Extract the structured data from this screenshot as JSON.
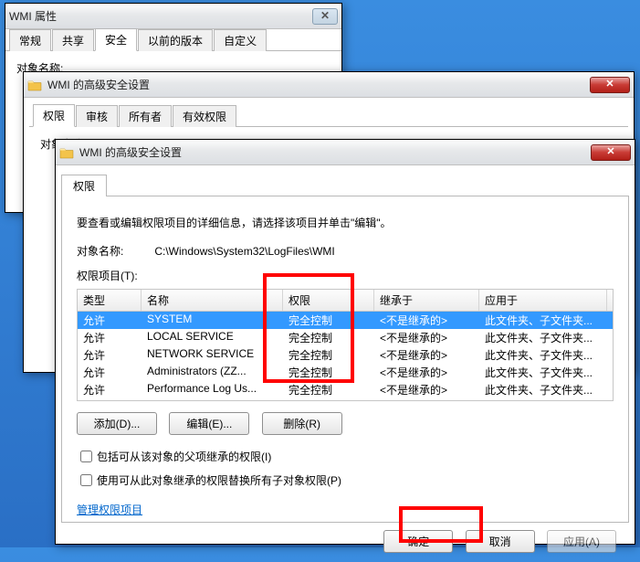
{
  "window1": {
    "title": "WMI 属性",
    "tabs": [
      "常规",
      "共享",
      "安全",
      "以前的版本",
      "自定义"
    ],
    "active_tab": 2,
    "obj_label": "对象名称:"
  },
  "window2": {
    "title": "WMI 的高级安全设置",
    "tabs": [
      "权限",
      "审核",
      "所有者",
      "有效权限"
    ],
    "active_tab": 0,
    "obj_label": "对象名称:"
  },
  "window3": {
    "title": "WMI 的高级安全设置",
    "tab_label": "权限",
    "instruction": "要查看或编辑权限项目的详细信息，请选择该项目并单击\"编辑\"。",
    "obj_label": "对象名称:",
    "obj_path": "C:\\Windows\\System32\\LogFiles\\WMI",
    "items_label": "权限项目(T):",
    "headers": {
      "type": "类型",
      "name": "名称",
      "perm": "权限",
      "inherit": "继承于",
      "apply": "应用于"
    },
    "rows": [
      {
        "type": "允许",
        "name": "SYSTEM",
        "perm": "完全控制",
        "inherit": "<不是继承的>",
        "apply": "此文件夹、子文件夹..."
      },
      {
        "type": "允许",
        "name": "LOCAL SERVICE",
        "perm": "完全控制",
        "inherit": "<不是继承的>",
        "apply": "此文件夹、子文件夹..."
      },
      {
        "type": "允许",
        "name": "NETWORK SERVICE",
        "perm": "完全控制",
        "inherit": "<不是继承的>",
        "apply": "此文件夹、子文件夹..."
      },
      {
        "type": "允许",
        "name": "Administrators (ZZ...",
        "perm": "完全控制",
        "inherit": "<不是继承的>",
        "apply": "此文件夹、子文件夹..."
      },
      {
        "type": "允许",
        "name": "Performance Log Us...",
        "perm": "完全控制",
        "inherit": "<不是继承的>",
        "apply": "此文件夹、子文件夹..."
      }
    ],
    "add_btn": "添加(D)...",
    "edit_btn": "编辑(E)...",
    "remove_btn": "删除(R)",
    "chk_include": "包括可从该对象的父项继承的权限(I)",
    "chk_replace": "使用可从此对象继承的权限替换所有子对象权限(P)",
    "manage_link": "管理权限项目",
    "ok_btn": "确定",
    "cancel_btn": "取消",
    "apply_btn": "应用(A)"
  }
}
